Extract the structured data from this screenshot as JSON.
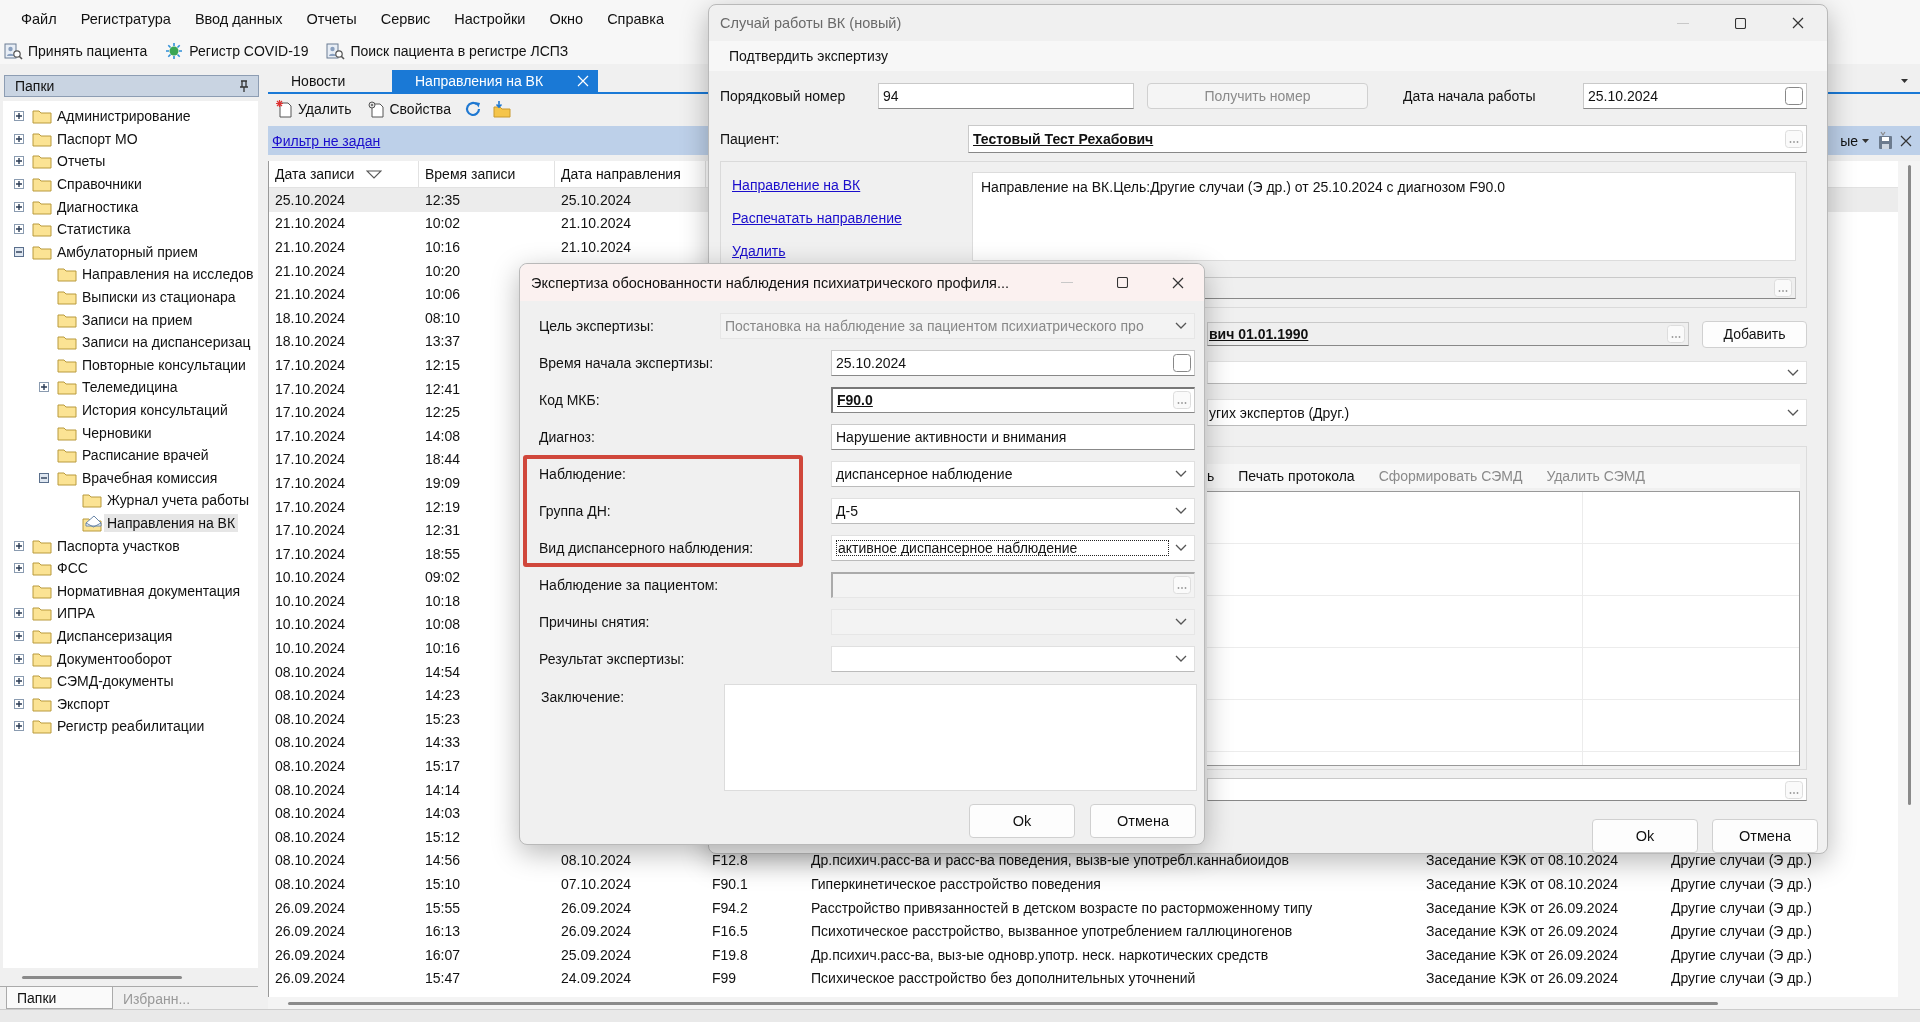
{
  "menu": [
    "Файл",
    "Регистратура",
    "Ввод данных",
    "Отчеты",
    "Сервис",
    "Настройки",
    "Окно",
    "Справка"
  ],
  "toolbar": [
    {
      "label": "Принять пациента",
      "kind": "patient"
    },
    {
      "label": "Регистр COVID-19",
      "kind": "virus"
    },
    {
      "label": "Поиск пациента в регистре ЛСПЗ",
      "kind": "patient"
    }
  ],
  "sidebar": {
    "title": "Папки",
    "tree": [
      {
        "label": "Администрирование",
        "kind": "branch",
        "expanded": false,
        "selected": false
      },
      {
        "label": "Паспорт МО",
        "kind": "branch",
        "expanded": false,
        "selected": false
      },
      {
        "label": "Отчеты",
        "kind": "branch",
        "expanded": false,
        "selected": false
      },
      {
        "label": "Справочники",
        "kind": "branch",
        "expanded": false,
        "selected": false
      },
      {
        "label": "Диагностика",
        "kind": "branch",
        "expanded": false,
        "selected": false
      },
      {
        "label": "Статистика",
        "kind": "branch",
        "expanded": false,
        "selected": false
      },
      {
        "label": "Амбулаторный прием",
        "kind": "branch",
        "expanded": true,
        "selected": false,
        "children": [
          {
            "label": "Направления на исследов",
            "kind": "leaf",
            "selected": false
          },
          {
            "label": "Выписки из стационара",
            "kind": "leaf",
            "selected": false
          },
          {
            "label": "Записи на прием",
            "kind": "leaf",
            "selected": false
          },
          {
            "label": "Записи на диспансеризац",
            "kind": "leaf",
            "selected": false
          },
          {
            "label": "Повторные консультации",
            "kind": "leaf",
            "selected": false
          },
          {
            "label": "Телемедицина",
            "kind": "branch",
            "expanded": false,
            "selected": false
          },
          {
            "label": "История консультаций",
            "kind": "leaf",
            "selected": false
          },
          {
            "label": "Черновики",
            "kind": "leaf",
            "selected": false
          },
          {
            "label": "Расписание врачей",
            "kind": "leaf",
            "selected": false
          },
          {
            "label": "Врачебная комиссия",
            "kind": "branch",
            "expanded": true,
            "selected": false,
            "children": [
              {
                "label": "Журнал учета работы",
                "kind": "leaf",
                "selected": false
              },
              {
                "label": "Направления на ВК",
                "kind": "letter",
                "selected": true
              }
            ]
          }
        ]
      },
      {
        "label": "Паспорта участков",
        "kind": "branch",
        "expanded": false,
        "selected": false
      },
      {
        "label": "ФСС",
        "kind": "branch",
        "expanded": false,
        "selected": false
      },
      {
        "label": "Нормативная документация",
        "kind": "leaf",
        "selected": false
      },
      {
        "label": "ИПРА",
        "kind": "branch",
        "expanded": false,
        "selected": false
      },
      {
        "label": "Диспансеризация",
        "kind": "branch",
        "expanded": false,
        "selected": false
      },
      {
        "label": "Документооборот",
        "kind": "branch",
        "expanded": false,
        "selected": false
      },
      {
        "label": "СЭМД-документы",
        "kind": "branch",
        "expanded": false,
        "selected": false
      },
      {
        "label": "Экспорт",
        "kind": "branch",
        "expanded": false,
        "selected": false
      },
      {
        "label": "Регистр реабилитации",
        "kind": "branch",
        "expanded": false,
        "selected": false
      }
    ],
    "tabs": [
      {
        "label": "Папки",
        "selected": true
      },
      {
        "label": "Избранн...",
        "selected": false
      }
    ]
  },
  "tabs": [
    {
      "label": "Новости",
      "selected": false,
      "closable": false
    },
    {
      "label": "Направления на ВК",
      "selected": true,
      "closable": true
    }
  ],
  "list_toolbar": [
    {
      "kind": "delete",
      "label": "Удалить"
    },
    {
      "kind": "properties",
      "label": "Свойства"
    },
    {
      "kind": "refresh"
    },
    {
      "kind": "folder"
    }
  ],
  "filter": {
    "label": "Фильтр не задан"
  },
  "grid_menu": {
    "label": "ые"
  },
  "table": {
    "columns": [
      {
        "label": "Дата записи",
        "sorted": true
      },
      {
        "label": "Время записи",
        "sorted": false
      },
      {
        "label": "Дата направления",
        "sorted": false
      }
    ],
    "rows": [
      {
        "selected": true,
        "cells": [
          "25.10.2024",
          "12:35",
          "25.10.2024"
        ]
      },
      {
        "selected": false,
        "cells": [
          "21.10.2024",
          "10:02",
          "21.10.2024"
        ]
      },
      {
        "selected": false,
        "cells": [
          "21.10.2024",
          "10:16",
          "21.10.2024"
        ]
      },
      {
        "selected": false,
        "cells": [
          "21.10.2024",
          "10:20"
        ]
      },
      {
        "selected": false,
        "cells": [
          "21.10.2024",
          "10:06"
        ]
      },
      {
        "selected": false,
        "cells": [
          "18.10.2024",
          "08:10"
        ]
      },
      {
        "selected": false,
        "cells": [
          "18.10.2024",
          "13:37"
        ]
      },
      {
        "selected": false,
        "cells": [
          "17.10.2024",
          "12:15"
        ]
      },
      {
        "selected": false,
        "cells": [
          "17.10.2024",
          "12:41"
        ]
      },
      {
        "selected": false,
        "cells": [
          "17.10.2024",
          "12:25"
        ]
      },
      {
        "selected": false,
        "cells": [
          "17.10.2024",
          "14:08"
        ]
      },
      {
        "selected": false,
        "cells": [
          "17.10.2024",
          "18:44"
        ]
      },
      {
        "selected": false,
        "cells": [
          "17.10.2024",
          "19:09"
        ]
      },
      {
        "selected": false,
        "cells": [
          "17.10.2024",
          "12:19"
        ]
      },
      {
        "selected": false,
        "cells": [
          "17.10.2024",
          "12:31"
        ]
      },
      {
        "selected": false,
        "cells": [
          "17.10.2024",
          "18:55"
        ]
      },
      {
        "selected": false,
        "cells": [
          "10.10.2024",
          "09:02"
        ]
      },
      {
        "selected": false,
        "cells": [
          "10.10.2024",
          "10:18"
        ]
      },
      {
        "selected": false,
        "cells": [
          "10.10.2024",
          "10:08"
        ]
      },
      {
        "selected": false,
        "cells": [
          "10.10.2024",
          "10:16"
        ]
      },
      {
        "selected": false,
        "cells": [
          "08.10.2024",
          "14:54"
        ]
      },
      {
        "selected": false,
        "cells": [
          "08.10.2024",
          "14:23"
        ]
      },
      {
        "selected": false,
        "cells": [
          "08.10.2024",
          "15:23"
        ]
      },
      {
        "selected": false,
        "cells": [
          "08.10.2024",
          "14:33"
        ]
      },
      {
        "selected": false,
        "cells": [
          "08.10.2024",
          "15:17"
        ]
      },
      {
        "selected": false,
        "cells": [
          "08.10.2024",
          "14:14"
        ]
      },
      {
        "selected": false,
        "cells": [
          "08.10.2024",
          "14:03"
        ]
      },
      {
        "selected": false,
        "cells": [
          "08.10.2024",
          "15:12"
        ]
      },
      {
        "selected": false,
        "cells": [
          "08.10.2024",
          "14:56",
          "08.10.2024",
          "F12.8",
          "Др.психич.расс-ва и расс-ва поведения, вызв-ые употребл.каннабиоидов",
          "Заседание КЭК от 08.10.2024",
          "Другие случаи (Э др.)"
        ]
      },
      {
        "selected": false,
        "cells": [
          "08.10.2024",
          "15:10",
          "07.10.2024",
          "F90.1",
          "Гиперкинетическое расстройство поведения",
          "Заседание КЭК от 08.10.2024",
          "Другие случаи (Э др.)"
        ]
      },
      {
        "selected": false,
        "cells": [
          "26.09.2024",
          "15:55",
          "26.09.2024",
          "F94.2",
          "Расстройство привязанностей в детском возрасте по расторможенному типу",
          "Заседание КЭК от 26.09.2024",
          "Другие случаи (Э др.)"
        ]
      },
      {
        "selected": false,
        "cells": [
          "26.09.2024",
          "16:13",
          "26.09.2024",
          "F16.5",
          "Психотическое расстройство, вызванное употреблением галлюциногенов",
          "Заседание КЭК от 26.09.2024",
          "Другие случаи (Э др.)"
        ]
      },
      {
        "selected": false,
        "cells": [
          "26.09.2024",
          "16:07",
          "25.09.2024",
          "F19.8",
          "Др.психич.расс-ва, выз-ые одновр.употр. неск. наркотических средств",
          "Заседание КЭК от 26.09.2024",
          "Другие случаи (Э др.)"
        ]
      },
      {
        "selected": false,
        "cells": [
          "26.09.2024",
          "15:47",
          "24.09.2024",
          "F99",
          "Психическое расстройство без дополнительных уточнений",
          "Заседание КЭК от 26.09.2024",
          "Другие случаи (Э др.)"
        ]
      }
    ]
  },
  "case_window": {
    "title": "Случай работы ВК (новый)",
    "menu": [
      "Подтвердить экспертизу"
    ],
    "number": {
      "label": "Порядковый номер",
      "value": "94"
    },
    "get_number": {
      "label": "Получить номер",
      "disabled": true
    },
    "start_date": {
      "label": "Дата начала работы",
      "value": "25.10.2024",
      "checked": false
    },
    "patient": {
      "label": "Пациент:",
      "value": "Тестовый Тест Рехабович"
    },
    "links": [
      "Направление на ВК",
      "Распечатать направление",
      "Удалить"
    ],
    "referral_text": "Направление на ВК.Цель:Другие случаи (Э др.) от 25.10.2024 с диагнозом F90.0",
    "expert": {
      "value": "вич 01.01.1990"
    },
    "add_button": "Добавить",
    "commission": {
      "value": "угих экспертов (Друг.)"
    },
    "protocol_toolbar": [
      {
        "label": "ь",
        "disabled": false
      },
      {
        "label": "Печать протокола",
        "disabled": false
      },
      {
        "label": "Сформировать СЭМД",
        "disabled": true
      },
      {
        "label": "Удалить СЭМД",
        "disabled": true
      }
    ],
    "buttons": [
      "Ok",
      "Отмена"
    ]
  },
  "expertise_dialog": {
    "title": "Экспертиза обоснованности наблюдения психиатрического профиля...",
    "fields": [
      {
        "label": "Цель экспертизы:",
        "kind": "longcombo",
        "value": "Постановка на наблюдение за пациентом психиатрического про",
        "disabled": true,
        "focused": false,
        "highlighted": false
      },
      {
        "label": "Время начала экспертизы:",
        "kind": "date",
        "value": "25.10.2024",
        "checked": false,
        "disabled": false,
        "focused": false,
        "highlighted": false
      },
      {
        "label": "Код МКБ:",
        "kind": "lookup",
        "value": "F90.0",
        "disabled": false,
        "focused": false,
        "highlighted": false
      },
      {
        "label": "Диагноз:",
        "kind": "text",
        "value": "Нарушение активности и внимания",
        "disabled": false,
        "focused": false,
        "highlighted": false
      },
      {
        "label": "Наблюдение:",
        "kind": "combo",
        "value": "диспансерное наблюдение",
        "disabled": false,
        "focused": false,
        "highlighted": true
      },
      {
        "label": "Группа ДН:",
        "kind": "combo",
        "value": "Д-5",
        "disabled": false,
        "focused": false,
        "highlighted": true
      },
      {
        "label": "Вид диспансерного наблюдения:",
        "kind": "combo",
        "value": "активное диспансерное наблюдение",
        "disabled": false,
        "focused": true,
        "highlighted": true
      },
      {
        "label": "Наблюдение за пациентом:",
        "kind": "lookup",
        "disabled": true,
        "focused": false,
        "highlighted": false
      },
      {
        "label": "Причины снятия:",
        "kind": "combo",
        "disabled": true,
        "focused": false,
        "highlighted": false
      },
      {
        "label": "Результат экспертизы:",
        "kind": "combo",
        "disabled": false,
        "focused": false,
        "highlighted": false
      },
      {
        "label": "Заключение:",
        "kind": "memo",
        "disabled": false,
        "focused": false,
        "highlighted": false
      }
    ],
    "buttons": [
      "Ok",
      "Отмена"
    ]
  }
}
